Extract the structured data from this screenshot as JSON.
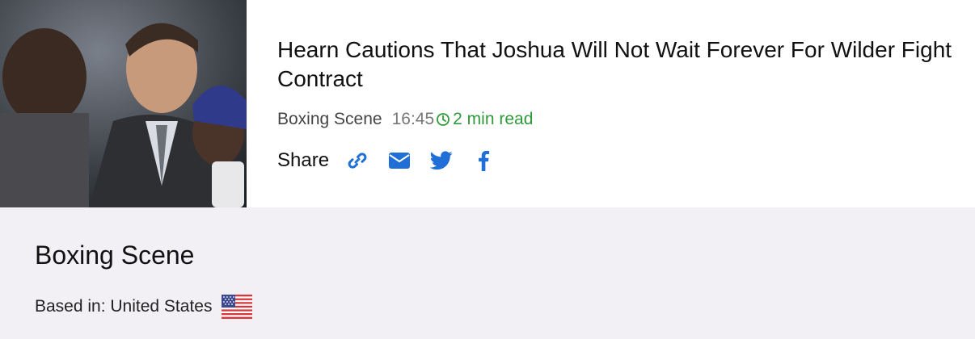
{
  "article": {
    "title": "Hearn Cautions That Joshua Will Not Wait Forever For Wilder Fight Contract",
    "source": "Boxing Scene",
    "time": "16:45",
    "read_time": "2 min read",
    "share_label": "Share",
    "thumbnail_alt": "Photo of boxing promoter beside fighter"
  },
  "share_icons": [
    "link-icon",
    "email-icon",
    "twitter-icon",
    "facebook-icon"
  ],
  "publisher": {
    "name": "Boxing Scene",
    "based_in": "Based in: United States",
    "flag": "us-flag-icon"
  },
  "colors": {
    "accent_blue": "#1f6fd6",
    "read_green": "#2e9a3a",
    "panel_bg": "#f2f0f5"
  }
}
